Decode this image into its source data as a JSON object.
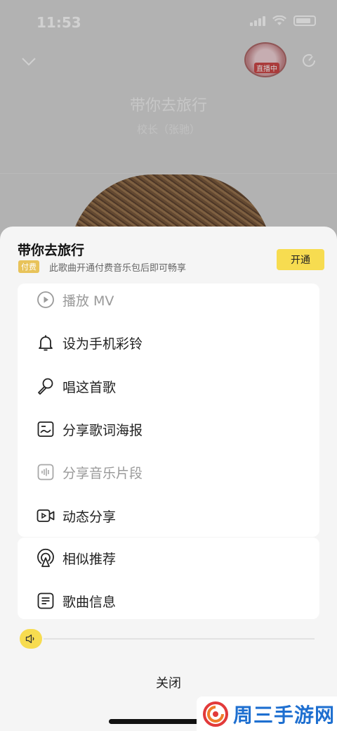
{
  "status_bar": {
    "time": "11:53"
  },
  "player": {
    "song_title": "带你去旅行",
    "artist": "校长（张驰）",
    "live_badge": "直播中"
  },
  "sheet": {
    "title": "带你去旅行",
    "paid_tag": "付费",
    "paid_note": "此歌曲开通付费音乐包后即可畅享",
    "open_button": "开通",
    "menu": [
      {
        "label": "播放 MV",
        "icon": "play-mv-icon",
        "disabled": true
      },
      {
        "label": "设为手机彩铃",
        "icon": "bell-icon",
        "disabled": false
      },
      {
        "label": "唱这首歌",
        "icon": "microphone-icon",
        "disabled": false
      },
      {
        "label": "分享歌词海报",
        "icon": "lyrics-poster-icon",
        "disabled": false
      },
      {
        "label": "分享音乐片段",
        "icon": "audio-clip-icon",
        "disabled": true
      },
      {
        "label": "动态分享",
        "icon": "video-share-icon",
        "disabled": false
      }
    ],
    "menu2": [
      {
        "label": "相似推荐",
        "icon": "similar-recommend-icon"
      },
      {
        "label": "歌曲信息",
        "icon": "song-info-icon"
      }
    ],
    "close_button": "关闭"
  },
  "watermark": {
    "text": "周三手游网"
  },
  "colors": {
    "accent": "#f7dc50",
    "paid_tag": "#e8c35a",
    "watermark": "#1e6fd0"
  }
}
